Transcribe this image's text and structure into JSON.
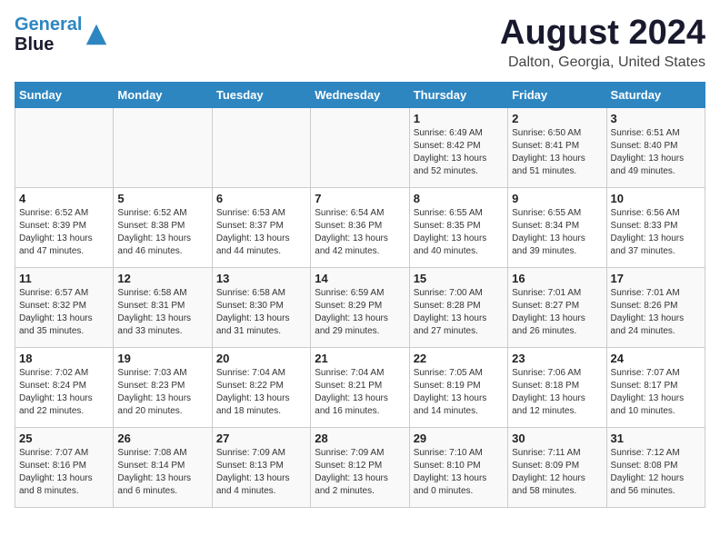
{
  "logo": {
    "line1": "General",
    "line2": "Blue"
  },
  "title": "August 2024",
  "location": "Dalton, Georgia, United States",
  "header": {
    "days": [
      "Sunday",
      "Monday",
      "Tuesday",
      "Wednesday",
      "Thursday",
      "Friday",
      "Saturday"
    ]
  },
  "weeks": [
    [
      {
        "day": "",
        "info": ""
      },
      {
        "day": "",
        "info": ""
      },
      {
        "day": "",
        "info": ""
      },
      {
        "day": "",
        "info": ""
      },
      {
        "day": "1",
        "info": "Sunrise: 6:49 AM\nSunset: 8:42 PM\nDaylight: 13 hours\nand 52 minutes."
      },
      {
        "day": "2",
        "info": "Sunrise: 6:50 AM\nSunset: 8:41 PM\nDaylight: 13 hours\nand 51 minutes."
      },
      {
        "day": "3",
        "info": "Sunrise: 6:51 AM\nSunset: 8:40 PM\nDaylight: 13 hours\nand 49 minutes."
      }
    ],
    [
      {
        "day": "4",
        "info": "Sunrise: 6:52 AM\nSunset: 8:39 PM\nDaylight: 13 hours\nand 47 minutes."
      },
      {
        "day": "5",
        "info": "Sunrise: 6:52 AM\nSunset: 8:38 PM\nDaylight: 13 hours\nand 46 minutes."
      },
      {
        "day": "6",
        "info": "Sunrise: 6:53 AM\nSunset: 8:37 PM\nDaylight: 13 hours\nand 44 minutes."
      },
      {
        "day": "7",
        "info": "Sunrise: 6:54 AM\nSunset: 8:36 PM\nDaylight: 13 hours\nand 42 minutes."
      },
      {
        "day": "8",
        "info": "Sunrise: 6:55 AM\nSunset: 8:35 PM\nDaylight: 13 hours\nand 40 minutes."
      },
      {
        "day": "9",
        "info": "Sunrise: 6:55 AM\nSunset: 8:34 PM\nDaylight: 13 hours\nand 39 minutes."
      },
      {
        "day": "10",
        "info": "Sunrise: 6:56 AM\nSunset: 8:33 PM\nDaylight: 13 hours\nand 37 minutes."
      }
    ],
    [
      {
        "day": "11",
        "info": "Sunrise: 6:57 AM\nSunset: 8:32 PM\nDaylight: 13 hours\nand 35 minutes."
      },
      {
        "day": "12",
        "info": "Sunrise: 6:58 AM\nSunset: 8:31 PM\nDaylight: 13 hours\nand 33 minutes."
      },
      {
        "day": "13",
        "info": "Sunrise: 6:58 AM\nSunset: 8:30 PM\nDaylight: 13 hours\nand 31 minutes."
      },
      {
        "day": "14",
        "info": "Sunrise: 6:59 AM\nSunset: 8:29 PM\nDaylight: 13 hours\nand 29 minutes."
      },
      {
        "day": "15",
        "info": "Sunrise: 7:00 AM\nSunset: 8:28 PM\nDaylight: 13 hours\nand 27 minutes."
      },
      {
        "day": "16",
        "info": "Sunrise: 7:01 AM\nSunset: 8:27 PM\nDaylight: 13 hours\nand 26 minutes."
      },
      {
        "day": "17",
        "info": "Sunrise: 7:01 AM\nSunset: 8:26 PM\nDaylight: 13 hours\nand 24 minutes."
      }
    ],
    [
      {
        "day": "18",
        "info": "Sunrise: 7:02 AM\nSunset: 8:24 PM\nDaylight: 13 hours\nand 22 minutes."
      },
      {
        "day": "19",
        "info": "Sunrise: 7:03 AM\nSunset: 8:23 PM\nDaylight: 13 hours\nand 20 minutes."
      },
      {
        "day": "20",
        "info": "Sunrise: 7:04 AM\nSunset: 8:22 PM\nDaylight: 13 hours\nand 18 minutes."
      },
      {
        "day": "21",
        "info": "Sunrise: 7:04 AM\nSunset: 8:21 PM\nDaylight: 13 hours\nand 16 minutes."
      },
      {
        "day": "22",
        "info": "Sunrise: 7:05 AM\nSunset: 8:19 PM\nDaylight: 13 hours\nand 14 minutes."
      },
      {
        "day": "23",
        "info": "Sunrise: 7:06 AM\nSunset: 8:18 PM\nDaylight: 13 hours\nand 12 minutes."
      },
      {
        "day": "24",
        "info": "Sunrise: 7:07 AM\nSunset: 8:17 PM\nDaylight: 13 hours\nand 10 minutes."
      }
    ],
    [
      {
        "day": "25",
        "info": "Sunrise: 7:07 AM\nSunset: 8:16 PM\nDaylight: 13 hours\nand 8 minutes."
      },
      {
        "day": "26",
        "info": "Sunrise: 7:08 AM\nSunset: 8:14 PM\nDaylight: 13 hours\nand 6 minutes."
      },
      {
        "day": "27",
        "info": "Sunrise: 7:09 AM\nSunset: 8:13 PM\nDaylight: 13 hours\nand 4 minutes."
      },
      {
        "day": "28",
        "info": "Sunrise: 7:09 AM\nSunset: 8:12 PM\nDaylight: 13 hours\nand 2 minutes."
      },
      {
        "day": "29",
        "info": "Sunrise: 7:10 AM\nSunset: 8:10 PM\nDaylight: 13 hours\nand 0 minutes."
      },
      {
        "day": "30",
        "info": "Sunrise: 7:11 AM\nSunset: 8:09 PM\nDaylight: 12 hours\nand 58 minutes."
      },
      {
        "day": "31",
        "info": "Sunrise: 7:12 AM\nSunset: 8:08 PM\nDaylight: 12 hours\nand 56 minutes."
      }
    ]
  ]
}
